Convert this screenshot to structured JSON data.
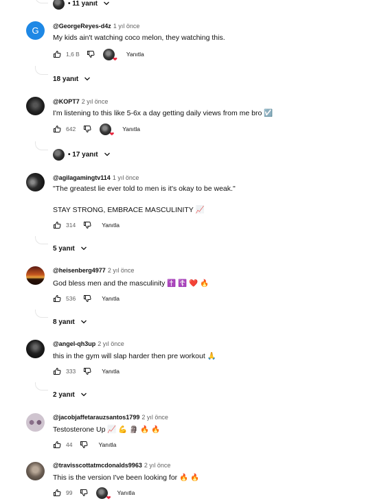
{
  "top_replies": {
    "label": "• 11 yanıt"
  },
  "comments": [
    {
      "author": "@GeorgeReyes-d4z",
      "time": "1 yıl önce",
      "lines": [
        "My kids ain't watching coco melon, they watching this."
      ],
      "likes": "1,6 B",
      "reply_label": "Yanıtla",
      "replies_label": "18 yanıt",
      "creator_heart": true,
      "avatar_letter": "G",
      "avatar_color": "#1e88e5"
    },
    {
      "author": "@KOPT7",
      "time": "2 yıl önce",
      "lines": [
        "I'm listening to this like 5-6x a day getting daily views from me bro ☑️"
      ],
      "likes": "642",
      "reply_label": "Yanıtla",
      "replies_label": "• 17 yanıt",
      "creator_heart": true
    },
    {
      "author": "@agilagamingtv114",
      "time": "1 yıl önce",
      "lines": [
        "\"The greatest lie ever told to men is it's okay to be weak.\"",
        "STAY STRONG, EMBRACE MASCULINITY 📈"
      ],
      "likes": "314",
      "reply_label": "Yanıtla",
      "replies_label": "5 yanıt"
    },
    {
      "author": "@heisenberg4977",
      "time": "2 yıl önce",
      "lines": [
        "God bless men and the masculinity ✝️ ☦️ ❤️ 🔥"
      ],
      "likes": "536",
      "reply_label": "Yanıtla",
      "replies_label": "8 yanıt"
    },
    {
      "author": "@angel-qh3up",
      "time": "2 yıl önce",
      "lines": [
        "this in the gym will slap harder then pre workout 🙏"
      ],
      "likes": "333",
      "reply_label": "Yanıtla",
      "replies_label": "2 yanıt"
    },
    {
      "author": "@jacobjaffetarauzsantos1799",
      "time": "2 yıl önce",
      "lines": [
        "Testosterone Up 📈 💪 🗿 🔥 🔥"
      ],
      "likes": "44",
      "reply_label": "Yanıtla"
    },
    {
      "author": "@travisscottatmcdonalds9963",
      "time": "2 yıl önce",
      "lines": [
        "This is the version I've been looking for 🔥 🔥"
      ],
      "likes": "99",
      "reply_label": "Yanıtla",
      "creator_heart": true
    }
  ]
}
